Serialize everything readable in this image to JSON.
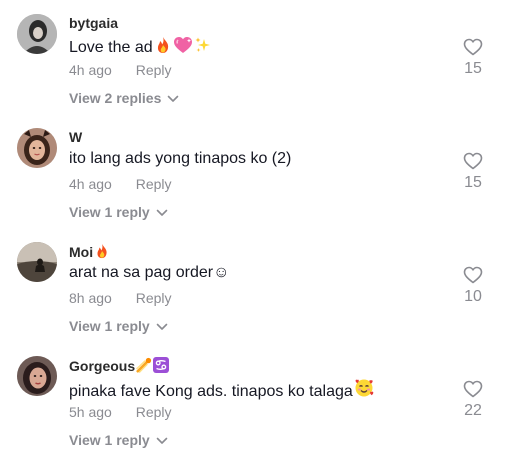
{
  "comments": [
    {
      "username": "bytgaia",
      "text": "Love the ad",
      "time": "4h ago",
      "reply_label": "Reply",
      "view_replies": "View 2 replies",
      "likes": "15",
      "username_emojis": [],
      "text_emojis": [
        "fire",
        "pink-heart",
        "sparkles"
      ]
    },
    {
      "username": "W",
      "text": "ito lang ads yong tinapos ko (2)",
      "time": "4h ago",
      "reply_label": "Reply",
      "view_replies": "View 1 reply",
      "likes": "15",
      "username_emojis": [],
      "text_emojis": []
    },
    {
      "username": "Moi",
      "text": "arat na sa pag order☺",
      "time": "8h ago",
      "reply_label": "Reply",
      "view_replies": "View 1 reply",
      "likes": "10",
      "username_emojis": [
        "fire"
      ],
      "text_emojis": []
    },
    {
      "username": "Gorgeous",
      "text": "pinaka fave Kong ads. tinapos ko talaga",
      "time": "5h ago",
      "reply_label": "Reply",
      "view_replies": "View 1 reply",
      "likes": "22",
      "username_emojis": [
        "comet",
        "cancer-sign"
      ],
      "text_emojis": [
        "smiling-face-with-hearts"
      ]
    }
  ],
  "colors": {
    "text_primary": "#161823",
    "text_secondary": "#8a8b91",
    "background": "#ffffff"
  }
}
